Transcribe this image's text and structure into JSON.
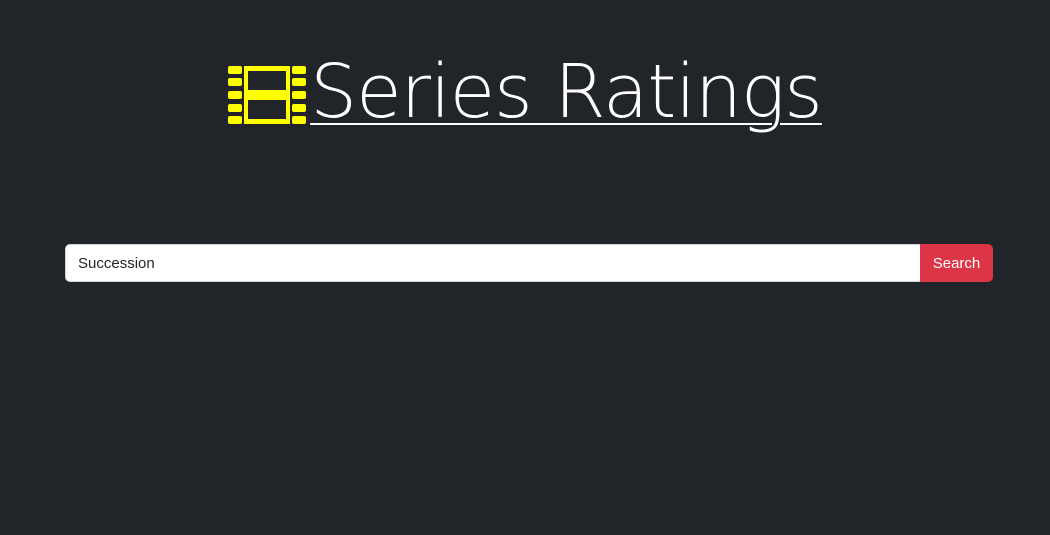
{
  "header": {
    "icon": "film-icon",
    "icon_color": "#ffff00",
    "title": "Series Ratings"
  },
  "search": {
    "value": "Succession",
    "button_label": "Search"
  },
  "colors": {
    "background": "#212529",
    "button": "#dc3545",
    "text": "#ffffff"
  }
}
